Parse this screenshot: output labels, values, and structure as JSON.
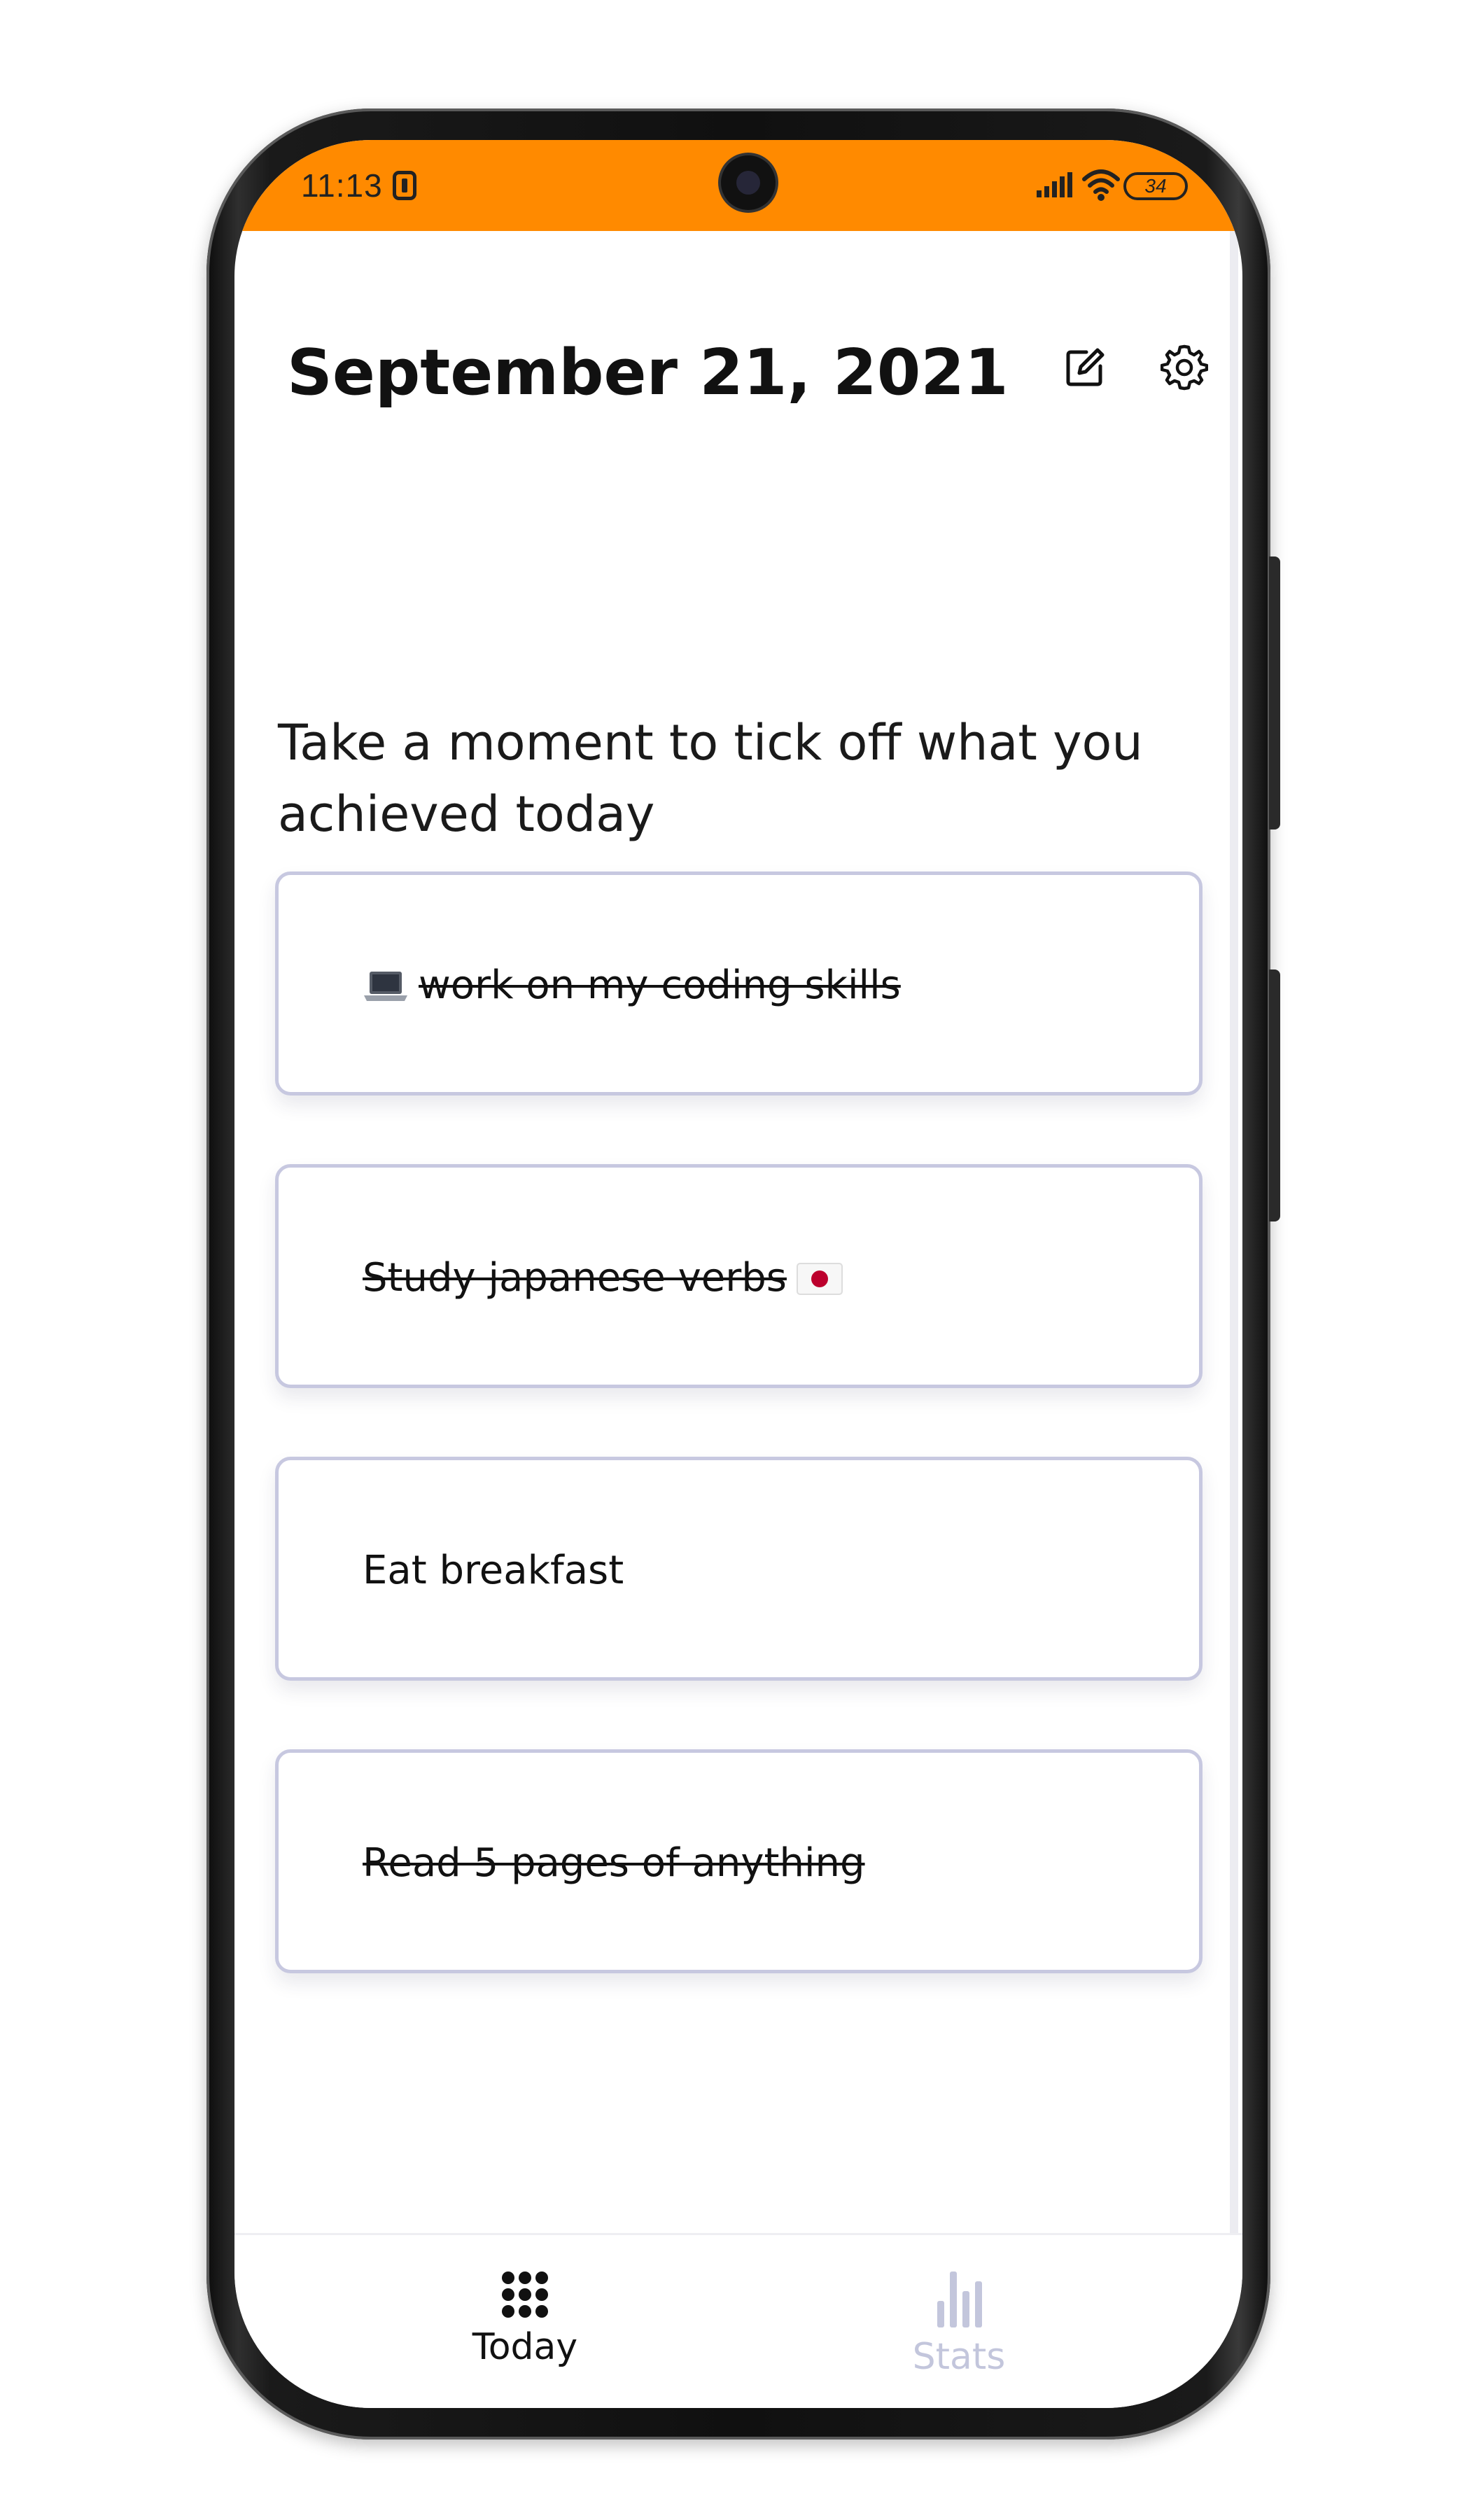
{
  "status_bar": {
    "time": "11:13",
    "battery": "34",
    "background_color": "#ff8a00"
  },
  "header": {
    "date": "September 21, 2021",
    "edit_icon": "edit-icon",
    "settings_icon": "gear-icon"
  },
  "prompt": "Take a moment to tick off what you achieved today",
  "tasks": [
    {
      "label": "work on my coding skills",
      "emoji": "laptop",
      "completed": true
    },
    {
      "label": "Study japanese verbs",
      "emoji": "japan-flag",
      "completed": true
    },
    {
      "label": "Eat breakfast",
      "completed": false
    },
    {
      "label": "Read 5 pages of anything",
      "completed": true
    }
  ],
  "bottom_nav": {
    "items": [
      {
        "label": "Today",
        "icon": "grid-dots-icon",
        "active": true
      },
      {
        "label": "Stats",
        "icon": "bar-chart-icon",
        "active": false
      }
    ]
  },
  "colors": {
    "accent": "#ff8a00",
    "card_border": "#c7c8e0",
    "inactive_nav": "#c3c6dc"
  }
}
